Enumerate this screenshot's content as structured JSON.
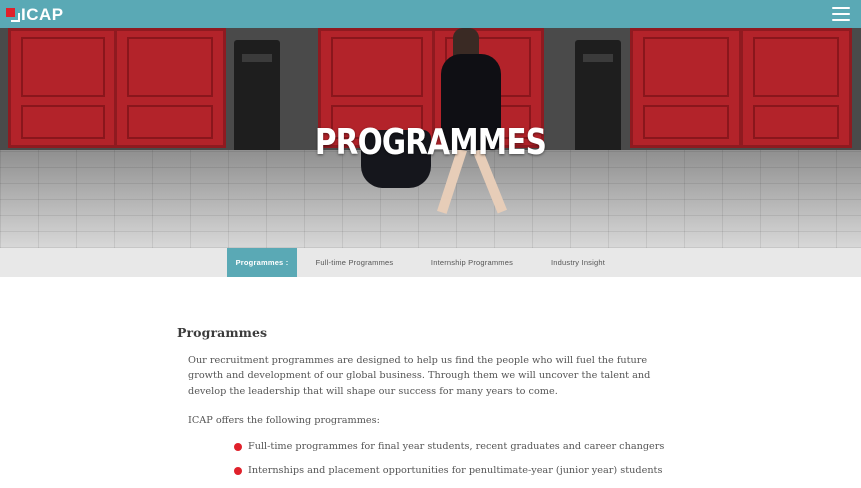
{
  "header": {
    "logo_text": "ICAP",
    "menu_icon": "hamburger-menu-icon",
    "bg_color": "#5aa9b5"
  },
  "hero": {
    "title": "PROGRAMMES"
  },
  "subnav": {
    "tabs": [
      {
        "label": "Programmes :",
        "active": true
      },
      {
        "label": "Full-time Programmes",
        "active": false
      },
      {
        "label": "Internship Programmes",
        "active": false
      },
      {
        "label": "Industry Insight",
        "active": false
      }
    ]
  },
  "content": {
    "heading": "Programmes",
    "paragraphs": [
      "Our recruitment programmes are designed to help us find the people who will fuel the future growth and development of our global business. Through them we will uncover the talent and develop the leadership that will shape our success for many years to come.",
      "ICAP offers the following programmes:"
    ],
    "bullets": [
      "Full-time programmes for final year students, recent graduates and career changers",
      "Internships and placement opportunities for penultimate-year (junior year) students"
    ],
    "bullet_color": "#e0212b"
  }
}
